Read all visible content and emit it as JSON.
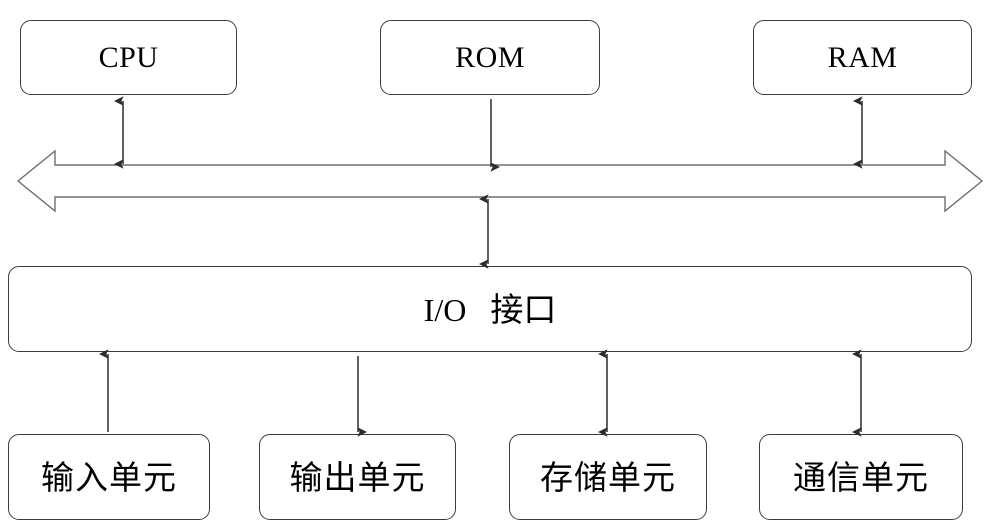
{
  "diagram": {
    "title": "Embedded System Bus Block Diagram",
    "background_color": "#ffffff",
    "line_color": "#3c3c3c",
    "arrow_color": "#2b2b2b",
    "text_color": "#000000"
  },
  "top_modules": [
    {
      "id": "cpu",
      "label": "CPU",
      "script": "latin"
    },
    {
      "id": "rom",
      "label": "ROM",
      "script": "latin"
    },
    {
      "id": "ram",
      "label": "RAM",
      "script": "latin"
    }
  ],
  "bus": {
    "id": "system-bus",
    "label": "",
    "style": "hollow-double-headed-arrow",
    "direction": "bidirectional-horizontal"
  },
  "interface": {
    "id": "io-interface",
    "label": "I/O 接口",
    "label_latin": "I/O",
    "label_cjk": "接口"
  },
  "bottom_modules": [
    {
      "id": "input-unit",
      "label": "输入单元",
      "script": "cjk"
    },
    {
      "id": "output-unit",
      "label": "输出单元",
      "script": "cjk"
    },
    {
      "id": "storage-unit",
      "label": "存储单元",
      "script": "cjk"
    },
    {
      "id": "communication-unit",
      "label": "通信单元",
      "script": "cjk"
    }
  ],
  "connectors": [
    {
      "id": "cpu-bus",
      "from": "cpu",
      "to": "system-bus",
      "direction": "bidirectional"
    },
    {
      "id": "rom-bus",
      "from": "rom",
      "to": "system-bus",
      "direction": "down"
    },
    {
      "id": "ram-bus",
      "from": "ram",
      "to": "system-bus",
      "direction": "bidirectional"
    },
    {
      "id": "bus-io",
      "from": "system-bus",
      "to": "io-interface",
      "direction": "bidirectional"
    },
    {
      "id": "input-io",
      "from": "input-unit",
      "to": "io-interface",
      "direction": "up"
    },
    {
      "id": "io-output",
      "from": "io-interface",
      "to": "output-unit",
      "direction": "down"
    },
    {
      "id": "io-storage",
      "from": "io-interface",
      "to": "storage-unit",
      "direction": "bidirectional"
    },
    {
      "id": "io-communication",
      "from": "io-interface",
      "to": "communication-unit",
      "direction": "bidirectional"
    }
  ]
}
